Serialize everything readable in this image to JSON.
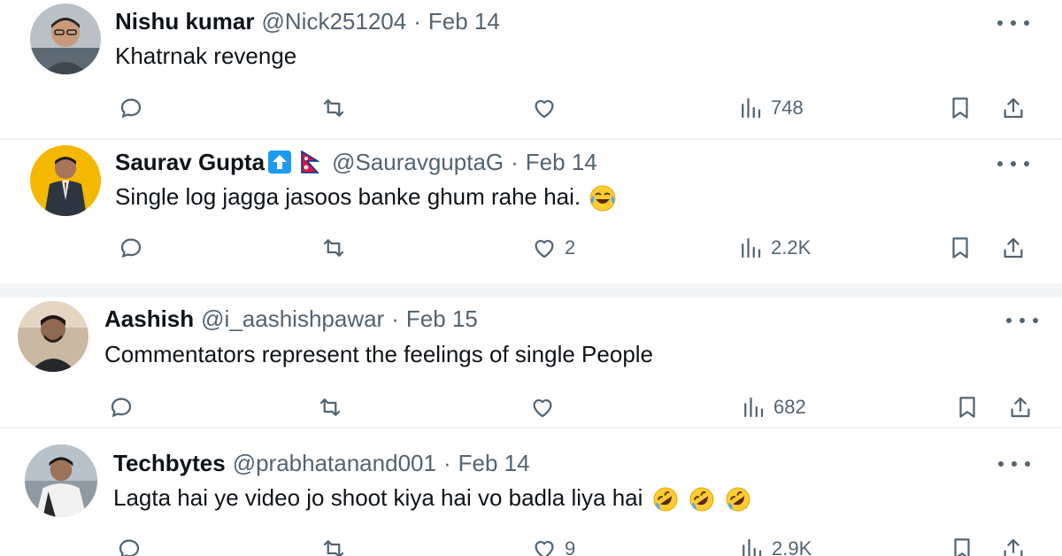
{
  "posts": [
    {
      "name": "Nishu kumar",
      "handle": "@Nick251204",
      "separator": "·",
      "date": "Feb 14",
      "text": "Khatrnak revenge",
      "likes": "",
      "views": "748",
      "avatar_bg": "#9aa3ad"
    },
    {
      "name": "Saurav Gupta",
      "handle": "@SauravguptaG",
      "separator": "·",
      "date": "Feb 14",
      "text": "Single log jagga jasoos banke ghum rahe hai.",
      "likes": "2",
      "views": "2.2K",
      "avatar_bg": "#f5b800"
    },
    {
      "name": "Aashish",
      "handle": "@i_aashishpawar",
      "separator": "·",
      "date": "Feb 15",
      "text": "Commentators represent the feelings of single People",
      "likes": "",
      "views": "682",
      "avatar_bg": "#6b5a4b"
    },
    {
      "name": "Techbytes",
      "handle": "@prabhatanand001",
      "separator": "·",
      "date": "Feb 14",
      "text": "Lagta hai ye video jo shoot kiya hai vo badla liya hai",
      "likes": "9",
      "views": "2.9K",
      "avatar_bg": "#7a8a96"
    }
  ],
  "icons": {
    "reply": "reply-icon",
    "repost": "repost-icon",
    "like": "heart-icon",
    "views": "views-icon",
    "bookmark": "bookmark-icon",
    "share": "share-icon",
    "more": "more-icon",
    "emoji_joy": "face-with-tears-of-joy",
    "emoji_rofl": "rolling-on-floor-laughing",
    "flag": "nepal-flag",
    "badge": "up-arrow-badge"
  },
  "colors": {
    "text": "#0f1419",
    "muted": "#536471",
    "accent": "#1d9bf0",
    "divider": "#eff3f4"
  }
}
